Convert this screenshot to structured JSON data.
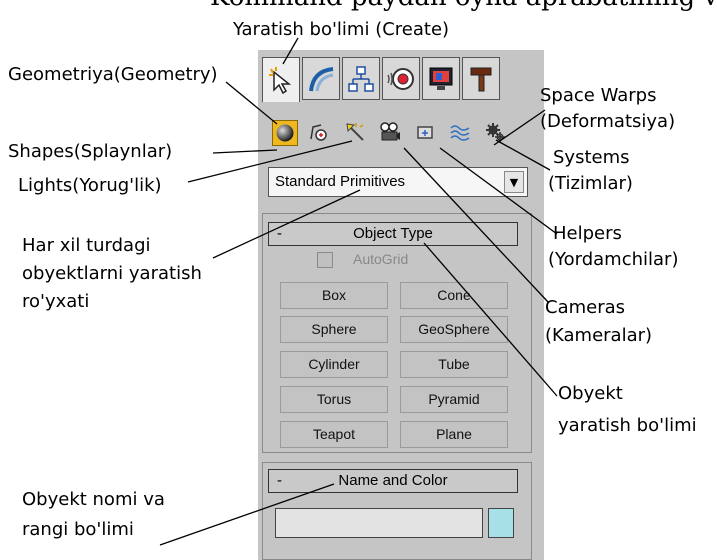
{
  "cut_text": "Kommand paydan oyna aprabatining viyasatulkatib bosq",
  "annotations": {
    "create": "Yaratish bo'limi (Create)",
    "geometry": "Geometriya(Geometry)",
    "space_warps": [
      "Space Warps",
      "(Deformatsiya)"
    ],
    "shapes": "Shapes(Splaynlar)",
    "systems": [
      "Systems",
      "(Tizimlar)"
    ],
    "lights": "Lights(Yorug'lik)",
    "object_list": [
      "Har xil turdagi",
      "obyektlarni yaratish",
      "ro'yxati"
    ],
    "helpers": [
      "Helpers",
      "(Yordamchilar)"
    ],
    "cameras": [
      "Cameras",
      "(Kameralar)"
    ],
    "object_type_section": [
      "Obyekt",
      "yaratish bo'limi"
    ],
    "name_color_section": [
      "Obyekt nomi va",
      "rangi bo'limi"
    ]
  },
  "panel": {
    "tabs": [
      {
        "name": "create-tab",
        "icon": "create-cursor-icon",
        "active": true
      },
      {
        "name": "modify-tab",
        "icon": "modify-curve-icon",
        "active": false
      },
      {
        "name": "hierarchy-tab",
        "icon": "hierarchy-icon",
        "active": false
      },
      {
        "name": "motion-tab",
        "icon": "motion-wheel-icon",
        "active": false
      },
      {
        "name": "display-tab",
        "icon": "display-monitor-icon",
        "active": false
      },
      {
        "name": "utilities-tab",
        "icon": "hammer-icon",
        "active": false
      }
    ],
    "categories": [
      {
        "name": "geometry",
        "icon": "sphere-icon",
        "active": true
      },
      {
        "name": "shapes",
        "icon": "shapes-icon"
      },
      {
        "name": "lights",
        "icon": "light-icon"
      },
      {
        "name": "cameras",
        "icon": "camera-icon"
      },
      {
        "name": "helpers",
        "icon": "helper-icon"
      },
      {
        "name": "space-warps",
        "icon": "wave-icon"
      },
      {
        "name": "systems",
        "icon": "gear-icon"
      }
    ],
    "dropdown": {
      "value": "Standard Primitives",
      "arrow": "▼"
    },
    "object_type": {
      "title": "Object Type",
      "collapse": "-",
      "autogrid_label": "AutoGrid",
      "autogrid_checked": false,
      "buttons": [
        "Box",
        "Cone",
        "Sphere",
        "GeoSphere",
        "Cylinder",
        "Tube",
        "Torus",
        "Pyramid",
        "Teapot",
        "Plane"
      ]
    },
    "name_color": {
      "title": "Name and Color",
      "collapse": "-",
      "name_value": "",
      "color": "#a8e0e8"
    }
  }
}
